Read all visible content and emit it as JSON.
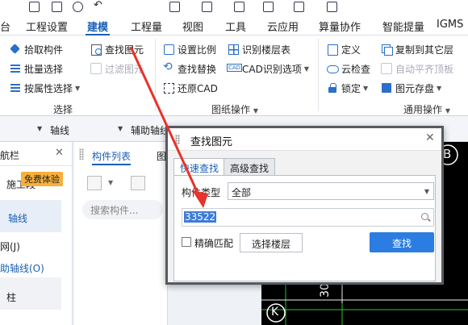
{
  "ribbon_tabs": [
    {
      "label": "台"
    },
    {
      "label": "工程设置"
    },
    {
      "label": "建模"
    },
    {
      "label": "工程量"
    },
    {
      "label": "视图"
    },
    {
      "label": "工具"
    },
    {
      "label": "云应用"
    },
    {
      "label": "算量协作"
    },
    {
      "label": "智能提量"
    },
    {
      "label": "IGMS"
    }
  ],
  "ribbon": {
    "group1": {
      "items": [
        "拾取构件",
        "批量选择",
        "按属性选择"
      ],
      "label": "选择"
    },
    "group1b": {
      "items": [
        "查找图元",
        "过滤图元"
      ]
    },
    "group2": {
      "items": [
        "设置比例",
        "识别楼层表",
        "查找替换",
        "CAD识别选项",
        "还原CAD"
      ],
      "label": "图纸操作"
    },
    "group3": {
      "items": [
        "定义",
        "复制到其它层",
        "云检查",
        "自动平齐顶板",
        "锁定",
        "图元存盘"
      ],
      "label": "通用操作"
    }
  },
  "bar2": {
    "axis": "轴线",
    "aux_axis": "辅助轴线"
  },
  "nav": {
    "title": "航栏",
    "items": [
      "施工段",
      "轴线",
      "网(J)",
      "助轴线(O)",
      "柱"
    ],
    "badge": "免费体验"
  },
  "panel": {
    "tab_list": "构件列表",
    "tab_other": "图",
    "search_placeholder": "搜索构件..."
  },
  "canvas": {
    "label_b": "B",
    "label_k": "K",
    "dim": "30"
  },
  "dialog": {
    "title": "查找图元",
    "tab_quick": "快速查找",
    "tab_advanced": "高级查找",
    "type_label": "构件类型",
    "type_value": "全部",
    "search_value": "33522",
    "exact_match": "精确匹配",
    "select_floor": "选择楼层",
    "find": "查找"
  },
  "colors": {
    "accent": "#1a5fb4",
    "find_button": "#2b7de1",
    "badge": "#f7b03a",
    "annotation_arrow": "#e8322b"
  }
}
